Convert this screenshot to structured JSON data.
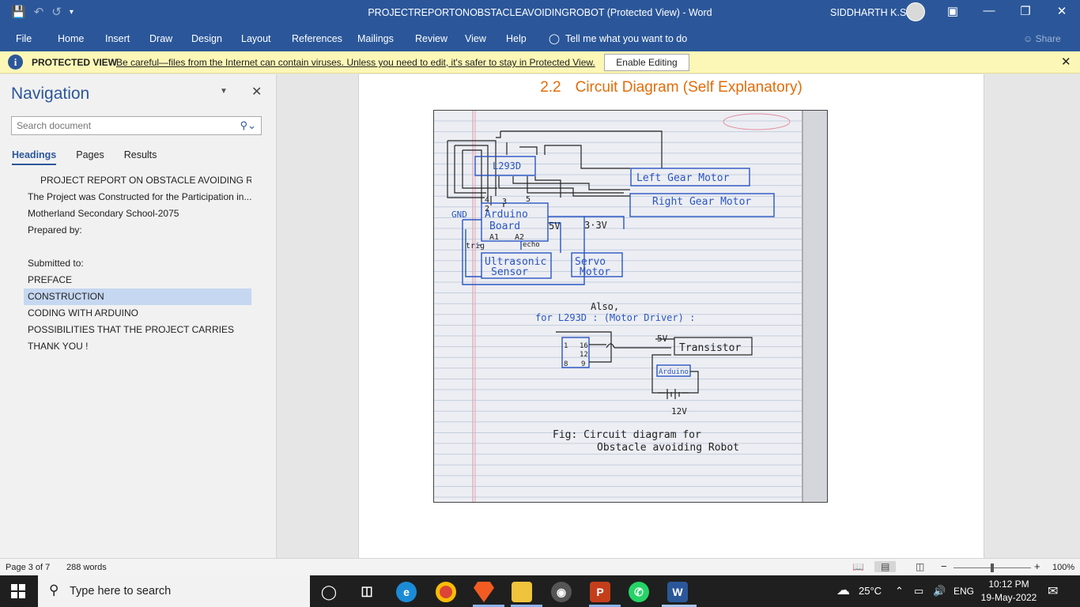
{
  "titlebar": {
    "doc_title": "PROJECTREPORTONOBSTACLEAVOIDINGROBOT (Protected View)  -  Word",
    "user": "SIDDHARTH K.S."
  },
  "ribbon": {
    "tabs": [
      "File",
      "Home",
      "Insert",
      "Draw",
      "Design",
      "Layout",
      "References",
      "Mailings",
      "Review",
      "View",
      "Help"
    ],
    "tell_me": "Tell me what you want to do",
    "share": "Share"
  },
  "protected_bar": {
    "label": "PROTECTED VIEW",
    "message": "Be careful—files from the Internet can contain viruses. Unless you need to edit, it's safer to stay in Protected View.",
    "enable_button": "Enable Editing"
  },
  "navigation": {
    "title": "Navigation",
    "search_placeholder": "Search document",
    "tabs": [
      "Headings",
      "Pages",
      "Results"
    ],
    "headings": [
      {
        "text": "PROJECT REPORT ON OBSTACLE AVOIDING ROB...",
        "level": 1
      },
      {
        "text": "The Project was Constructed for the Participation in...",
        "level": 0
      },
      {
        "text": "Motherland Secondary School-2075",
        "level": 0
      },
      {
        "text": "Prepared by:",
        "level": 0
      },
      {
        "text": "",
        "level": 0
      },
      {
        "text": "Submitted to:",
        "level": 0
      },
      {
        "text": "PREFACE",
        "level": 0
      },
      {
        "text": "CONSTRUCTION",
        "level": 0,
        "selected": true
      },
      {
        "text": "CODING WITH ARDUINO",
        "level": 0
      },
      {
        "text": "POSSIBILITIES THAT THE PROJECT CARRIES",
        "level": 0
      },
      {
        "text": "THANK YOU !",
        "level": 0
      }
    ]
  },
  "document": {
    "heading_number": "2.2",
    "heading_text": "Circuit Diagram (Self Explanatory)",
    "figure": {
      "title": "Circuit Diagram:",
      "labels": {
        "l293d": "L293D",
        "left_motor": "Left Gear Motor",
        "right_motor": "Right Gear Motor",
        "pins": [
          "4",
          "3",
          "5",
          "2"
        ],
        "gnd": "GND",
        "arduino_line1": "Arduino",
        "arduino_line2": "Board",
        "v5": "5V",
        "v33": "3·3V",
        "a1": "A1",
        "a2": "A2",
        "trig": "trig",
        "echo": "echo",
        "ultra1": "Ultrasonic",
        "ultra2": "Sensor",
        "servo1": "Servo",
        "servo2": "Motor",
        "also": "Also,",
        "for_l293d": "for  L293D : (Motor  Driver) :",
        "chip_pins": [
          "1",
          "16",
          "12",
          "8",
          "9"
        ],
        "v5b": "5V",
        "transistor": "Transistor",
        "arduino_small": "Arduino",
        "v12": "12V",
        "caption1": "Fig: Circuit  diagram  for",
        "caption2": "Obstacle  avoiding  Robot"
      }
    }
  },
  "statusbar": {
    "page": "Page 3 of 7",
    "words": "288 words",
    "zoom": "100%",
    "zoom_level": 1.0
  },
  "taskbar": {
    "search_placeholder": "Type here to search",
    "weather": "25°C",
    "lang": "ENG",
    "time": "10:12 PM",
    "date": "19-May-2022"
  }
}
